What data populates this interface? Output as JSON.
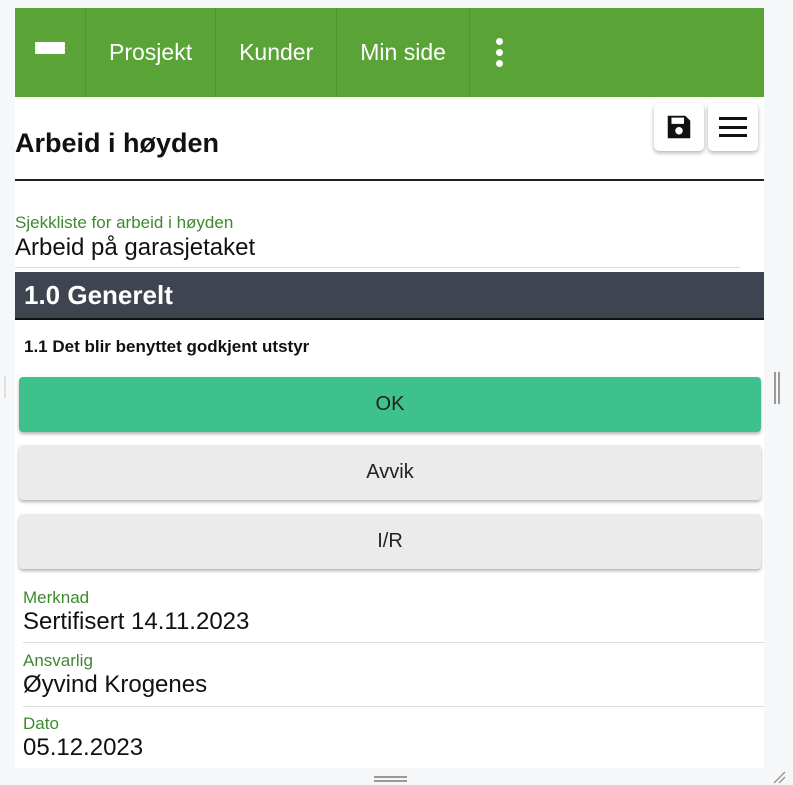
{
  "navbar": {
    "menu_icon": "hamburger-icon",
    "links": [
      "Prosjekt",
      "Kunder",
      "Min side"
    ],
    "more_icon": "vertical-dots-icon",
    "color": "#5aa336"
  },
  "toolbar": {
    "save_icon": "floppy-disk-icon",
    "menu_icon": "hamburger-icon"
  },
  "page": {
    "title": "Arbeid i høyden"
  },
  "checklist": {
    "label": "Sjekkliste for arbeid i høyden",
    "value": "Arbeid på garasjetaket"
  },
  "section": {
    "title": "1.0 Generelt",
    "color": "#3e4550"
  },
  "question": {
    "text": "1.1 Det blir benyttet godkjent utstyr",
    "options": [
      {
        "label": "OK",
        "selected": true,
        "color": "#3ec18d"
      },
      {
        "label": "Avvik",
        "selected": false
      },
      {
        "label": "I/R",
        "selected": false
      }
    ]
  },
  "details": {
    "merknad_label": "Merknad",
    "merknad_value": "Sertifisert 14.11.2023",
    "ansvarlig_label": "Ansvarlig",
    "ansvarlig_value": "Øyvind Krogenes",
    "dato_label": "Dato",
    "dato_value": "05.12.2023"
  }
}
